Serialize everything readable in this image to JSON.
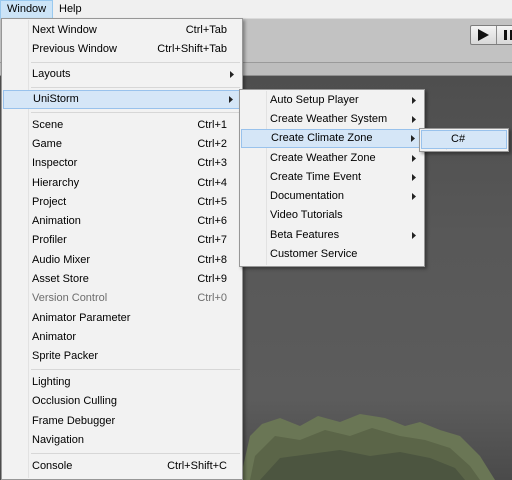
{
  "menubar": {
    "window_label": "Window",
    "help_label": "Help"
  },
  "window_menu": {
    "items": [
      {
        "label": "Next Window",
        "shortcut": "Ctrl+Tab"
      },
      {
        "label": "Previous Window",
        "shortcut": "Ctrl+Shift+Tab"
      },
      {
        "label": "Layouts",
        "shortcut": ""
      },
      {
        "label": "UniStorm",
        "shortcut": ""
      },
      {
        "label": "Scene",
        "shortcut": "Ctrl+1"
      },
      {
        "label": "Game",
        "shortcut": "Ctrl+2"
      },
      {
        "label": "Inspector",
        "shortcut": "Ctrl+3"
      },
      {
        "label": "Hierarchy",
        "shortcut": "Ctrl+4"
      },
      {
        "label": "Project",
        "shortcut": "Ctrl+5"
      },
      {
        "label": "Animation",
        "shortcut": "Ctrl+6"
      },
      {
        "label": "Profiler",
        "shortcut": "Ctrl+7"
      },
      {
        "label": "Audio Mixer",
        "shortcut": "Ctrl+8"
      },
      {
        "label": "Asset Store",
        "shortcut": "Ctrl+9"
      },
      {
        "label": "Version Control",
        "shortcut": "Ctrl+0"
      },
      {
        "label": "Animator Parameter",
        "shortcut": ""
      },
      {
        "label": "Animator",
        "shortcut": ""
      },
      {
        "label": "Sprite Packer",
        "shortcut": ""
      },
      {
        "label": "Lighting",
        "shortcut": ""
      },
      {
        "label": "Occlusion Culling",
        "shortcut": ""
      },
      {
        "label": "Frame Debugger",
        "shortcut": ""
      },
      {
        "label": "Navigation",
        "shortcut": ""
      },
      {
        "label": "Console",
        "shortcut": "Ctrl+Shift+C"
      }
    ]
  },
  "unistorm_menu": {
    "items": [
      {
        "label": "Auto Setup Player"
      },
      {
        "label": "Create Weather System"
      },
      {
        "label": "Create Climate Zone"
      },
      {
        "label": "Create Weather Zone"
      },
      {
        "label": "Create Time Event"
      },
      {
        "label": "Documentation"
      },
      {
        "label": "Video Tutorials"
      },
      {
        "label": "Beta Features"
      },
      {
        "label": "Customer Service"
      }
    ]
  },
  "climate_zone_menu": {
    "items": [
      {
        "label": "C#"
      }
    ]
  },
  "colors": {
    "menu_bg": "#f2f2f2",
    "highlight_bg": "#d5e6f7",
    "highlight_border": "#99c2ec",
    "disabled_text": "#6d6d6d"
  }
}
